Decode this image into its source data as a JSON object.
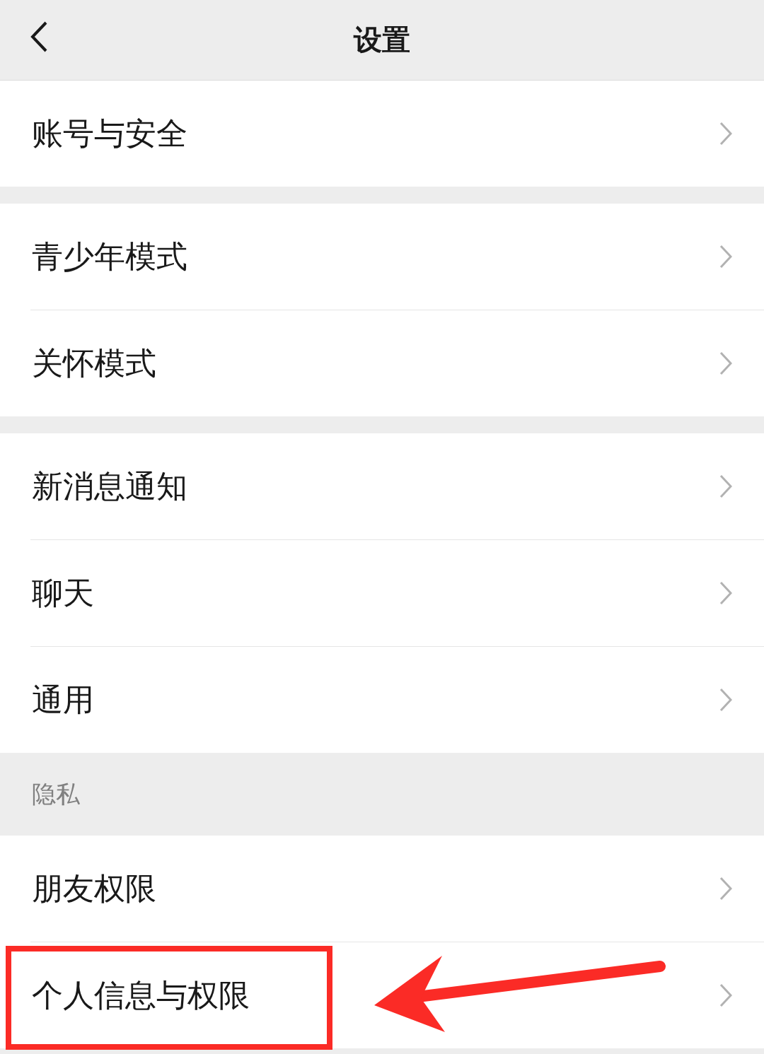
{
  "header": {
    "title": "设置"
  },
  "groups": [
    {
      "items": [
        {
          "label": "账号与安全",
          "highlighted": false
        }
      ]
    },
    {
      "items": [
        {
          "label": "青少年模式",
          "highlighted": false
        },
        {
          "label": "关怀模式",
          "highlighted": false
        }
      ]
    },
    {
      "items": [
        {
          "label": "新消息通知",
          "highlighted": false
        },
        {
          "label": "聊天",
          "highlighted": false
        },
        {
          "label": "通用",
          "highlighted": false
        }
      ]
    },
    {
      "section_title": "隐私",
      "items": [
        {
          "label": "朋友权限",
          "highlighted": false
        },
        {
          "label": "个人信息与权限",
          "highlighted": true
        }
      ]
    }
  ]
}
